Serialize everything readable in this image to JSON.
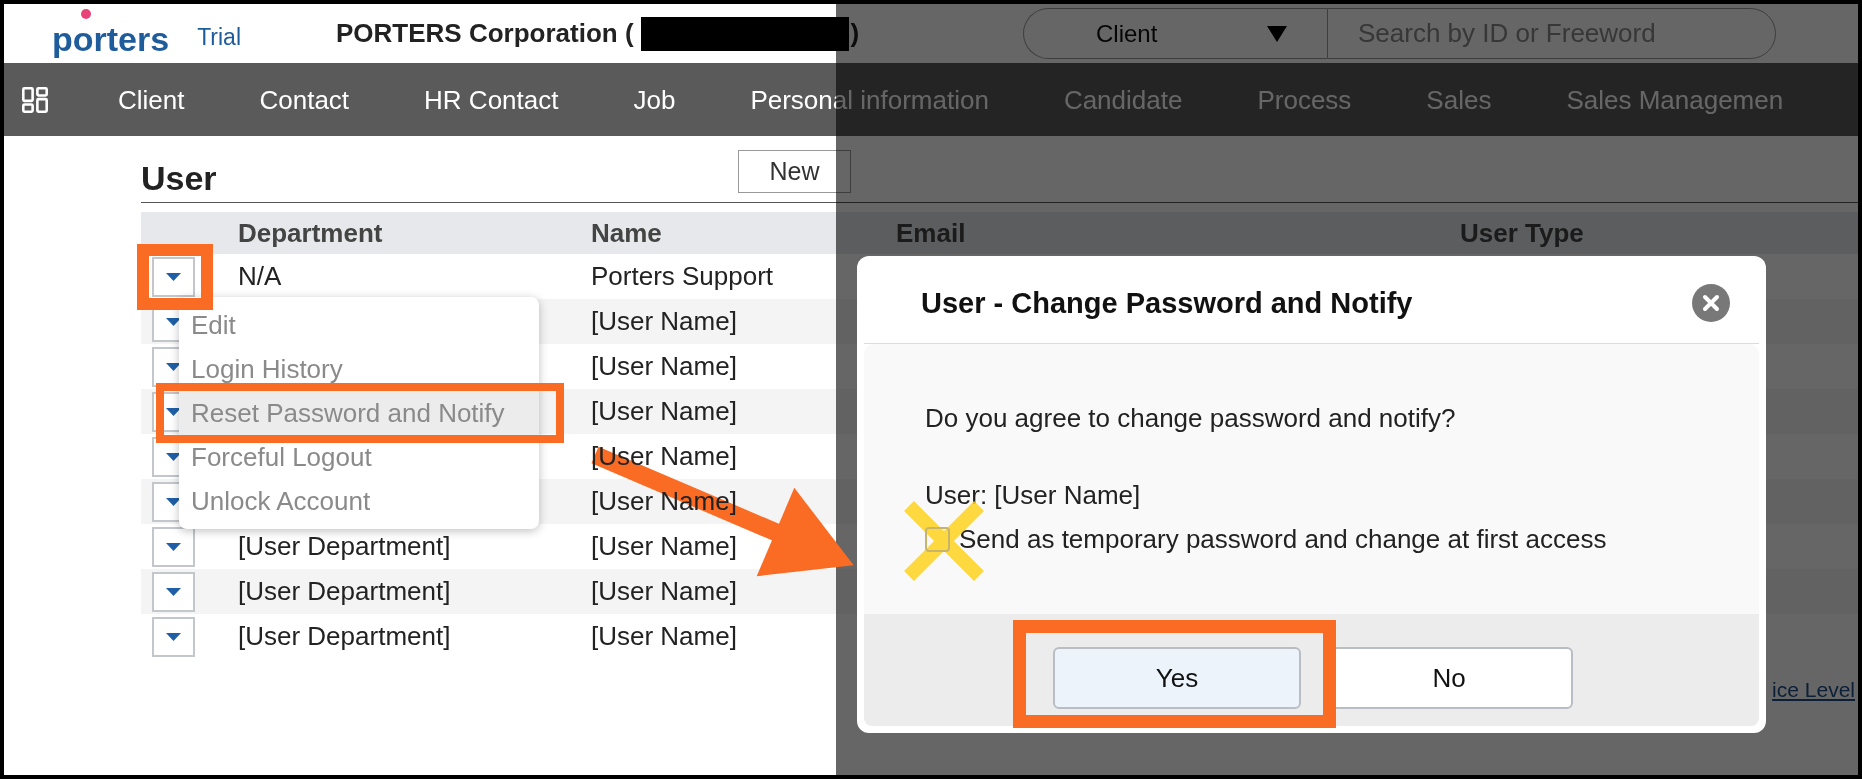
{
  "header": {
    "logo": "porters",
    "edition": "Trial",
    "company_prefix": "PORTERS Corporation (",
    "company_redacted": true,
    "company_suffix": ")",
    "search": {
      "scope": "Client",
      "placeholder": "Search by ID or Freeword"
    }
  },
  "nav": {
    "items": [
      "Client",
      "Contact",
      "HR Contact",
      "Job",
      "Personal information",
      "Candidate",
      "Process",
      "Sales",
      "Sales Managemen"
    ]
  },
  "page": {
    "title": "User",
    "new_button": "New"
  },
  "table": {
    "columns": [
      "Department",
      "Name",
      "Email",
      "User Type"
    ],
    "rows": [
      {
        "department": "N/A",
        "name": "Porters Support"
      },
      {
        "name": "[User Name]"
      },
      {
        "name": "[User Name]"
      },
      {
        "name": "[User Name]"
      },
      {
        "name": "[User Name]"
      },
      {
        "name": "[User Name]"
      },
      {
        "department": "[User Department]",
        "name": "[User Name]"
      },
      {
        "department": "[User Department]",
        "name": "[User Name]"
      },
      {
        "department": "[User Department]",
        "name": "[User Name]"
      }
    ]
  },
  "row_menu": {
    "items": [
      {
        "label": "Edit",
        "selected": false
      },
      {
        "label": "Login History",
        "selected": false
      },
      {
        "label": "Reset Password and Notify",
        "selected": true
      },
      {
        "label": "Forceful Logout",
        "selected": false
      },
      {
        "label": "Unlock Account",
        "selected": false
      }
    ]
  },
  "footer_link": "ice Level",
  "dialog": {
    "title": "User - Change Password and Notify",
    "message": "Do you agree to change password and notify?",
    "user_line": "User: [User Name]",
    "checkbox": {
      "label": "Send as temporary password and change at first access",
      "checked": false
    },
    "buttons": [
      {
        "label": "Yes",
        "focused": true
      },
      {
        "label": "No",
        "focused": false
      }
    ]
  }
}
